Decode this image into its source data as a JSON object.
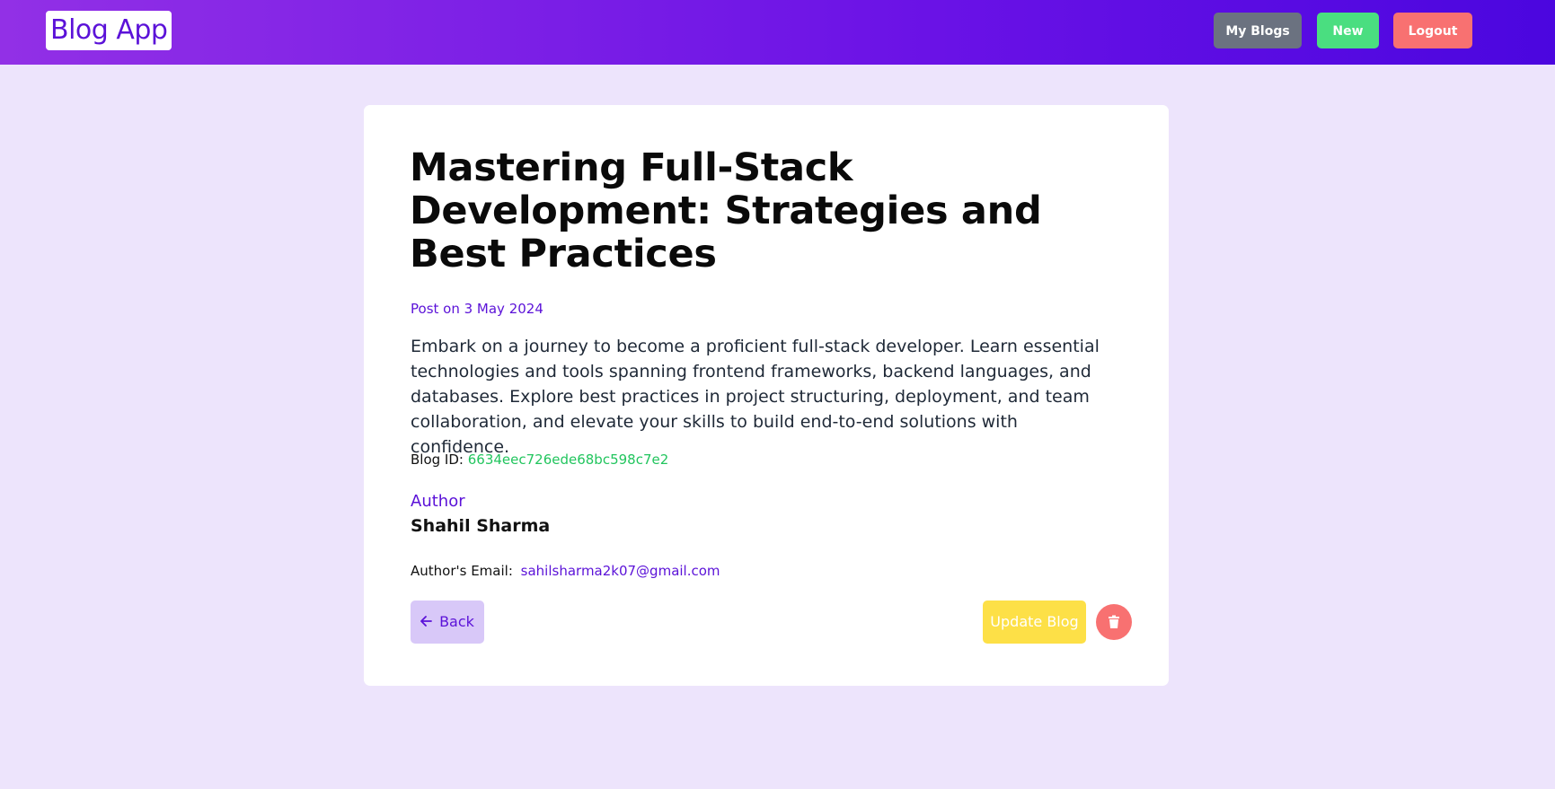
{
  "navbar": {
    "logo": "Blog App",
    "my_blogs_label": "My Blogs",
    "new_label": "New",
    "logout_label": "Logout"
  },
  "blog": {
    "title": "Mastering Full-Stack Development: Strategies and Best Practices",
    "post_date": "Post on 3 May 2024",
    "description": "Embark on a journey to become a proficient full-stack developer. Learn essential technologies and tools spanning frontend frameworks, backend languages, and databases. Explore best practices in project structuring, deployment, and team collaboration, and elevate your skills to build end-to-end solutions with confidence.",
    "blog_id_label": "Blog ID:",
    "blog_id": "6634eec726ede68bc598c7e2",
    "author_label": "Author",
    "author_name": "Shahil Sharma",
    "author_email_label": "Author's Email:",
    "author_email": "sahilsharma2k07@gmail.com"
  },
  "actions": {
    "back_label": "Back",
    "back_icon": "arrow-left-icon",
    "update_label": "Update Blog",
    "delete_icon": "trash-icon"
  },
  "colors": {
    "accent": "#5b12d8",
    "page_bg": "#ede4fc",
    "my_blogs_btn": "#6b7280",
    "new_btn": "#4ade80",
    "logout_btn": "#f87171",
    "update_btn": "#fde047",
    "delete_btn": "#f87171",
    "blog_id_text": "#22c55e"
  }
}
